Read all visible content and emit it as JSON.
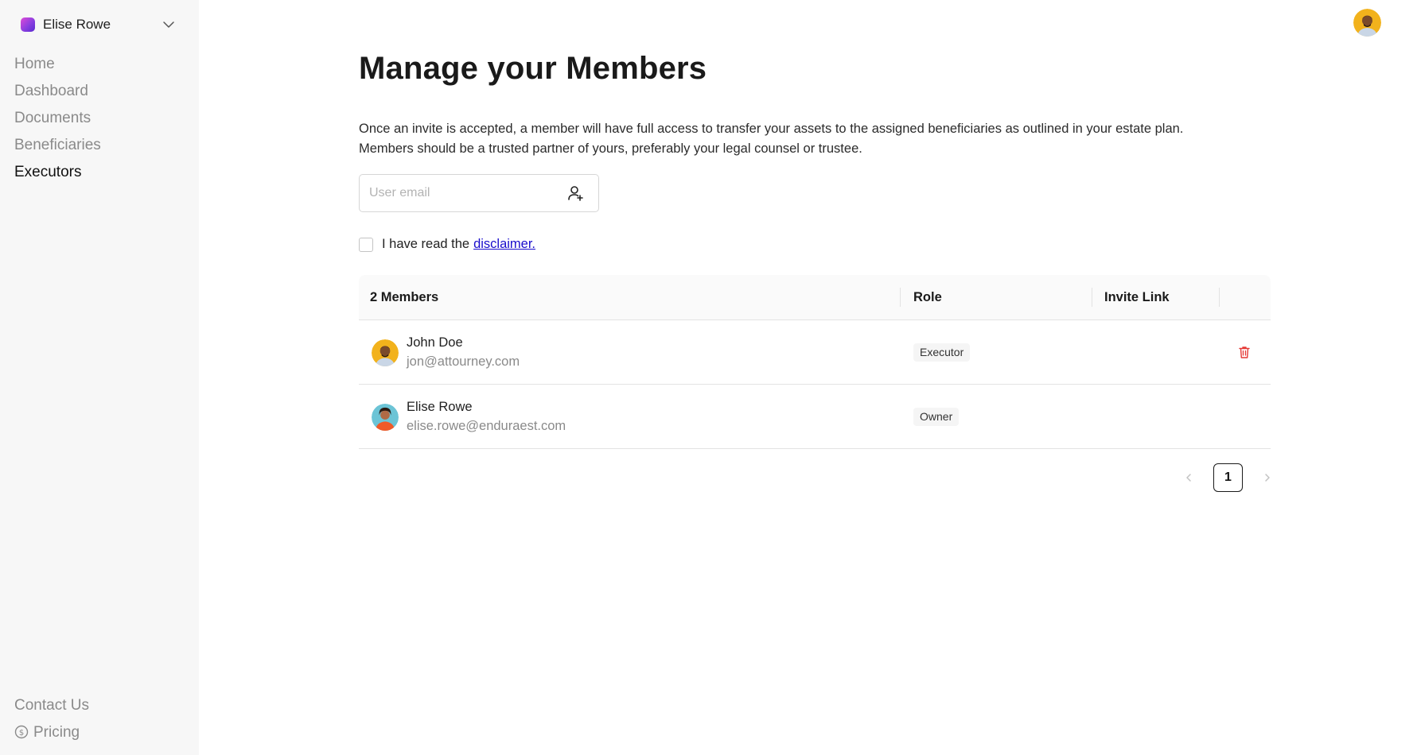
{
  "workspace": {
    "name": "Elise Rowe",
    "logo_gradient": [
      "#e04bd6",
      "#5a2bd0"
    ]
  },
  "nav": {
    "items": [
      {
        "label": "Home",
        "active": false
      },
      {
        "label": "Dashboard",
        "active": false
      },
      {
        "label": "Documents",
        "active": false
      },
      {
        "label": "Beneficiaries",
        "active": false
      },
      {
        "label": "Executors",
        "active": true
      }
    ],
    "bottom": [
      {
        "label": "Contact Us"
      },
      {
        "label": "Pricing",
        "icon": "dollar-circle-icon"
      }
    ]
  },
  "page": {
    "title": "Manage your Members",
    "description_line1": "Once an invite is accepted, a member will have full access to transfer your assets to the assigned beneficiaries as outlined in your estate plan.",
    "description_line2": "Members should be a trusted partner of yours, preferably your legal counsel or trustee.",
    "email_placeholder": "User email",
    "email_value": "",
    "disclaimer_text": "I have read the",
    "disclaimer_link": "disclaimer.",
    "disclaimer_checked": false
  },
  "table": {
    "headers": {
      "members": "2 Members",
      "role": "Role",
      "invite": "Invite Link"
    },
    "rows": [
      {
        "name": "John Doe",
        "email": "jon@attourney.com",
        "role": "Executor",
        "avatar": "man-avatar",
        "deletable": true
      },
      {
        "name": "Elise Rowe",
        "email": "elise.rowe@enduraest.com",
        "role": "Owner",
        "avatar": "woman-avatar",
        "deletable": false
      }
    ]
  },
  "pagination": {
    "current": "1"
  },
  "colors": {
    "accent_link": "#1a0dcc",
    "danger": "#e53935",
    "sidebar_bg": "#f7f7f7"
  }
}
